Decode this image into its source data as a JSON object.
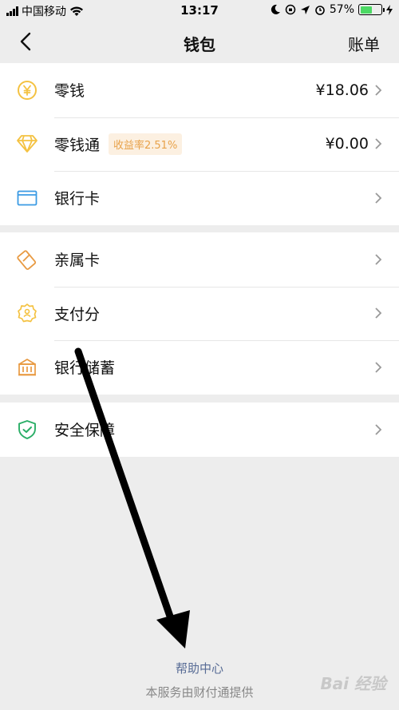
{
  "status": {
    "carrier": "中国移动",
    "time": "13:17",
    "battery": "57%",
    "battery_level": 0.57
  },
  "nav": {
    "title": "钱包",
    "right": "账单"
  },
  "groups": [
    {
      "items": [
        {
          "label": "零钱",
          "value": "¥18.06",
          "icon": "yuan-coin-icon"
        },
        {
          "label": "零钱通",
          "badge": "收益率2.51%",
          "value": "¥0.00",
          "icon": "diamond-icon"
        },
        {
          "label": "银行卡",
          "icon": "bank-card-icon"
        }
      ]
    },
    {
      "items": [
        {
          "label": "亲属卡",
          "icon": "family-card-icon"
        },
        {
          "label": "支付分",
          "icon": "pay-score-icon"
        },
        {
          "label": "银行储蓄",
          "icon": "bank-savings-icon"
        }
      ]
    },
    {
      "items": [
        {
          "label": "安全保障",
          "icon": "shield-icon"
        }
      ]
    }
  ],
  "footer": {
    "help_link": "帮助中心",
    "provider": "本服务由财付通提供"
  },
  "watermark": "Bai 经验",
  "colors": {
    "background": "#ededed",
    "link": "#576b95",
    "badge_text": "#e8a24a",
    "badge_bg": "#fcf0e1",
    "yellow_icon": "#f4c242",
    "blue_icon": "#3b9be4",
    "orange_icon": "#e89a42",
    "green_icon": "#2bae67"
  }
}
